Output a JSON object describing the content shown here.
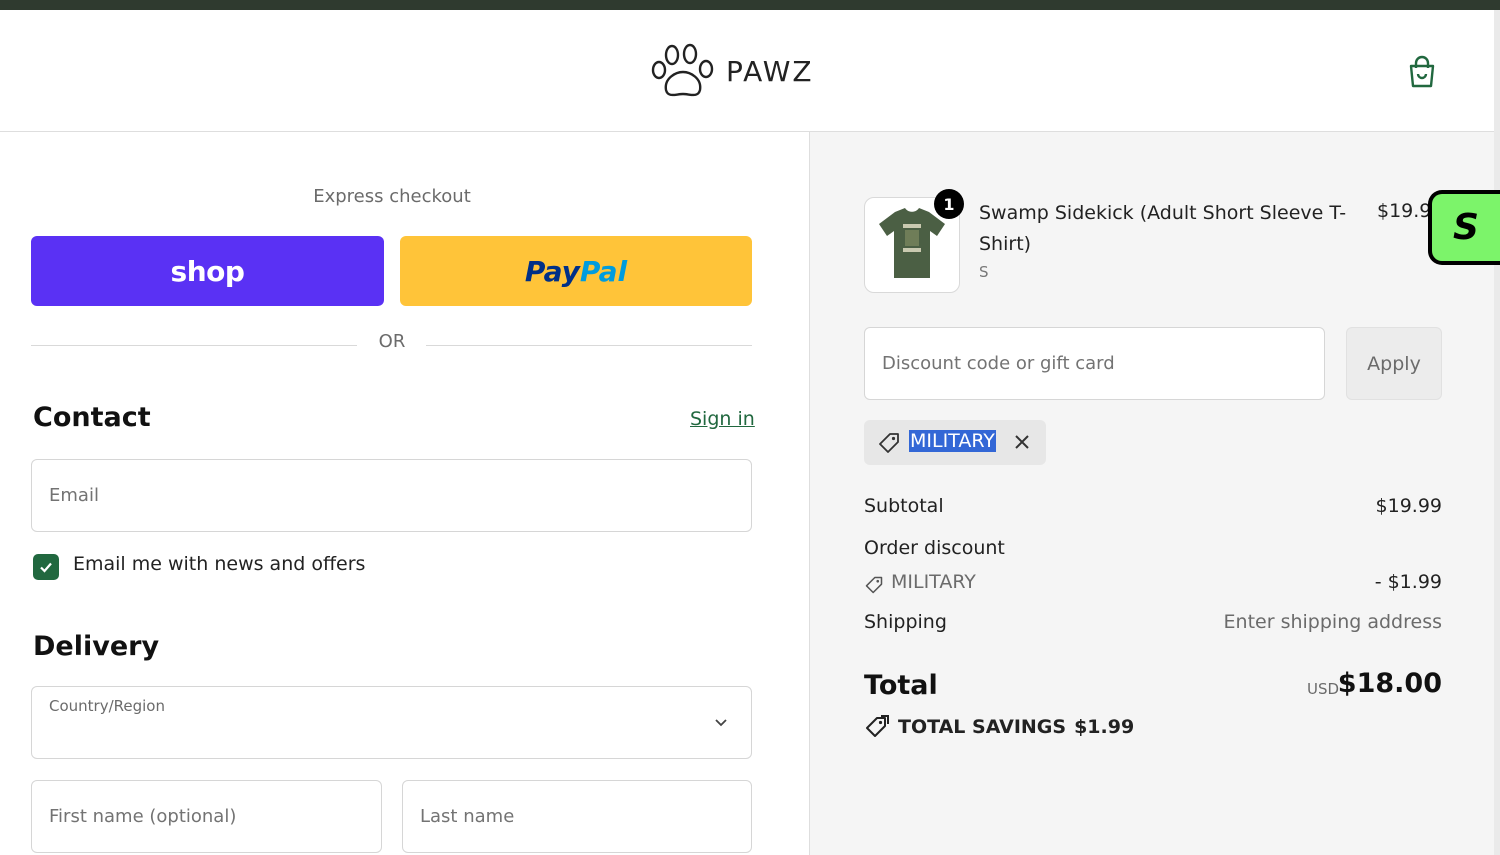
{
  "header": {
    "brand": "PAWZ",
    "logo_icon": "paw-icon",
    "cart_icon": "shopping-bag-icon"
  },
  "express": {
    "label": "Express checkout",
    "shop_label": "shop",
    "paypal_label_a": "Pay",
    "paypal_label_b": "Pal",
    "or_label": "OR"
  },
  "contact": {
    "heading": "Contact",
    "signin_label": "Sign in",
    "email_placeholder": "Email",
    "newsletter_label": "Email me with news and offers",
    "newsletter_checked": true
  },
  "delivery": {
    "heading": "Delivery",
    "country_label": "Country/Region",
    "first_name_placeholder": "First name (optional)",
    "last_name_placeholder": "Last name"
  },
  "summary": {
    "item": {
      "quantity": "1",
      "name": "Swamp Sidekick (Adult Short Sleeve T-Shirt)",
      "variant": "S",
      "price": "$19.99"
    },
    "side_badge": "S",
    "discount_placeholder": "Discount code or gift card",
    "apply_label": "Apply",
    "applied_code": "MILITARY",
    "subtotal_label": "Subtotal",
    "subtotal_value": "$19.99",
    "order_discount_label": "Order discount",
    "discount_code": "MILITARY",
    "discount_value": "- $1.99",
    "shipping_label": "Shipping",
    "shipping_value": "Enter shipping address",
    "total_label": "Total",
    "currency": "USD",
    "total_value": "$18.00",
    "savings_label": "TOTAL SAVINGS",
    "savings_value": "$1.99"
  },
  "colors": {
    "shop": "#5a31f4",
    "paypal": "#ffc439",
    "accent": "#21683f",
    "badge": "#7cf46a"
  }
}
